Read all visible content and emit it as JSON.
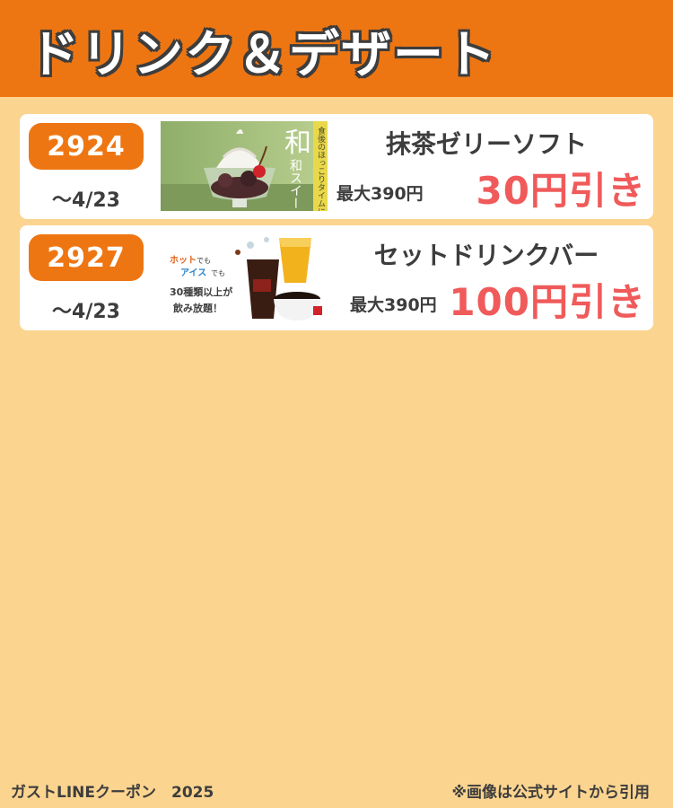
{
  "header": {
    "title": "ドリンク＆デザート"
  },
  "colors": {
    "accent": "#ee7612",
    "background": "#fbd48f",
    "discount": "#f05a5a",
    "text": "#3d3d3d"
  },
  "coupons": [
    {
      "code": "2924",
      "expiry": "〜4/23",
      "name": "抹茶ゼリーソフト",
      "max_price": "最大390円",
      "discount": "30円引き",
      "image": {
        "icon": "matcha-parfait-image",
        "big_text": "和スイーツ",
        "side_text": "食後のほっこりタイムに"
      }
    },
    {
      "code": "2927",
      "expiry": "〜4/23",
      "name": "セットドリンクバー",
      "max_price": "最大390円",
      "discount": "100円引き",
      "image": {
        "icon": "drinks-image",
        "line1a": "ホット",
        "line1b": "でも",
        "line2a": "アイス",
        "line2b": "でも",
        "line3": "30種類以上が",
        "line4": "飲み放題！"
      }
    }
  ],
  "footer": {
    "left": "ガストLINEクーポン　2025",
    "right": "※画像は公式サイトから引用"
  }
}
